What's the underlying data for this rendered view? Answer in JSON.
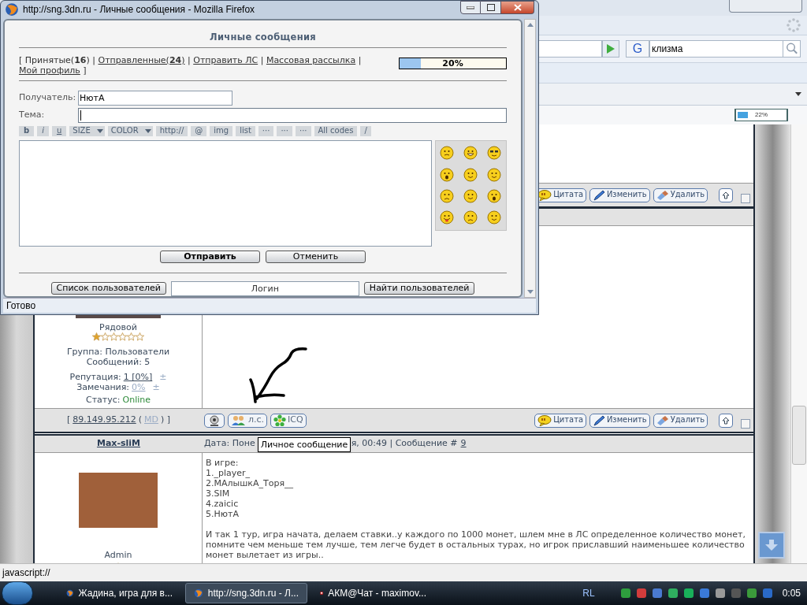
{
  "popup": {
    "title": "http://sng.3dn.ru - Личные сообщения - Mozilla Firefox",
    "heading": "Личные сообщения",
    "nav_open": "[",
    "nav": [
      {
        "label": "Принятые(**16**)",
        "selected": true,
        "after": "|"
      },
      {
        "label": "Отправленные(**24**)",
        "selected": false,
        "after": "|"
      },
      {
        "label": "Отправить ЛС",
        "selected": false,
        "after": "|"
      },
      {
        "label": "Массовая рассылка",
        "selected": false,
        "after": "|"
      },
      {
        "label": "Мой профиль",
        "selected": false,
        "after": "]"
      }
    ],
    "quota": {
      "level": 0.2,
      "reading": "20%"
    },
    "recipient": {
      "label": "Получатель:",
      "value": "НютА"
    },
    "subject": {
      "label": "Тема:",
      "focused": true
    },
    "format_buttons": [
      {
        "label": "b",
        "kind": "bold"
      },
      {
        "label": "i",
        "kind": "italic"
      },
      {
        "label": "u",
        "kind": "underline"
      },
      {
        "label": "SIZE",
        "kind": "dropdown"
      },
      {
        "label": "COLOR",
        "kind": "dropdown"
      },
      {
        "label": "http://",
        "kind": "plain"
      },
      {
        "label": "@",
        "kind": "plain"
      },
      {
        "label": "img",
        "kind": "plain"
      },
      {
        "label": "list",
        "kind": "plain"
      },
      {
        "label": "···",
        "kind": "plain"
      },
      {
        "label": "···",
        "kind": "plain"
      },
      {
        "label": "···",
        "kind": "plain"
      },
      {
        "label": "All codes",
        "kind": "plain"
      },
      {
        "label": "/",
        "kind": "plain"
      }
    ],
    "send_button": "Отправить",
    "cancel_button": "Отменить",
    "user_list_button": "Список пользователей",
    "login_field": {
      "value": "Логин"
    },
    "find_users_button": "Найти пользователей",
    "status": "Готово"
  },
  "browser": {
    "search_engine": "G",
    "search": {
      "value": "клизма"
    },
    "zoom_meter": {
      "level": 0.22,
      "reading": "22%"
    }
  },
  "posts": [
    {
      "actions": [
        "Цитата",
        "Изменить",
        "Удалить"
      ],
      "checked": false
    },
    {
      "rank": "Рядовой",
      "stars": 1,
      "group": "Группа: Пользователи",
      "messages": "Сообщений: 5",
      "reputation_label": "Репутация:",
      "reputation": "1 [0%]",
      "reputation_change": "±",
      "warnings_label": "Замечания:",
      "warnings": "0%",
      "warnings_change": "±",
      "status_label": "Статус:",
      "status": "Online",
      "ip_line": [
        {
          "kind": "text",
          "text": "["
        },
        {
          "kind": "link",
          "text": "89.149.95.212"
        },
        {
          "kind": "text",
          "text": "("
        },
        {
          "kind": "faded-link",
          "text": "MD"
        },
        {
          "kind": "text",
          "text": ") ]"
        }
      ],
      "contacts": [
        {
          "kind": "webcam"
        },
        {
          "kind": "pm",
          "label": "л.с."
        },
        {
          "kind": "icq",
          "label": "ICQ"
        }
      ],
      "actions": [
        "Цитата",
        "Изменить",
        "Удалить"
      ],
      "checked": false
    },
    {
      "author": "Max-sliM",
      "date_start": "Дата: Поне",
      "date_end": "я, 00:49 | Сообщение #",
      "number": "9",
      "body": [
        "В игре:",
        "1._player_",
        "2.МАлышкА_Торя__",
        "3.SIM",
        "4.zaicic",
        "5.НютА"
      ],
      "paragraph": "И так 1 тур, игра начата, делаем ставки..у каждого по 1000 монет, шлем мне в ЛС определенное количество монет, помните чем меньше тем лучше, тем легче будет в остальных турах, но игрок приславший наименьшее количество монет вылетает из игры..",
      "rank": "Admin"
    }
  ],
  "tooltip": "Личное сообщение",
  "status_bar": "javascript://",
  "taskbar": {
    "tasks": [
      {
        "label": "Жадина, игра для в...",
        "selected": false,
        "kind": "firefox"
      },
      {
        "label": "http://sng.3dn.ru - Л...",
        "selected": true,
        "kind": "firefox"
      },
      {
        "label": "АКМ@Чат - maximov...",
        "selected": false,
        "kind": "chat"
      }
    ],
    "language": "RL",
    "clock": "0:05"
  }
}
